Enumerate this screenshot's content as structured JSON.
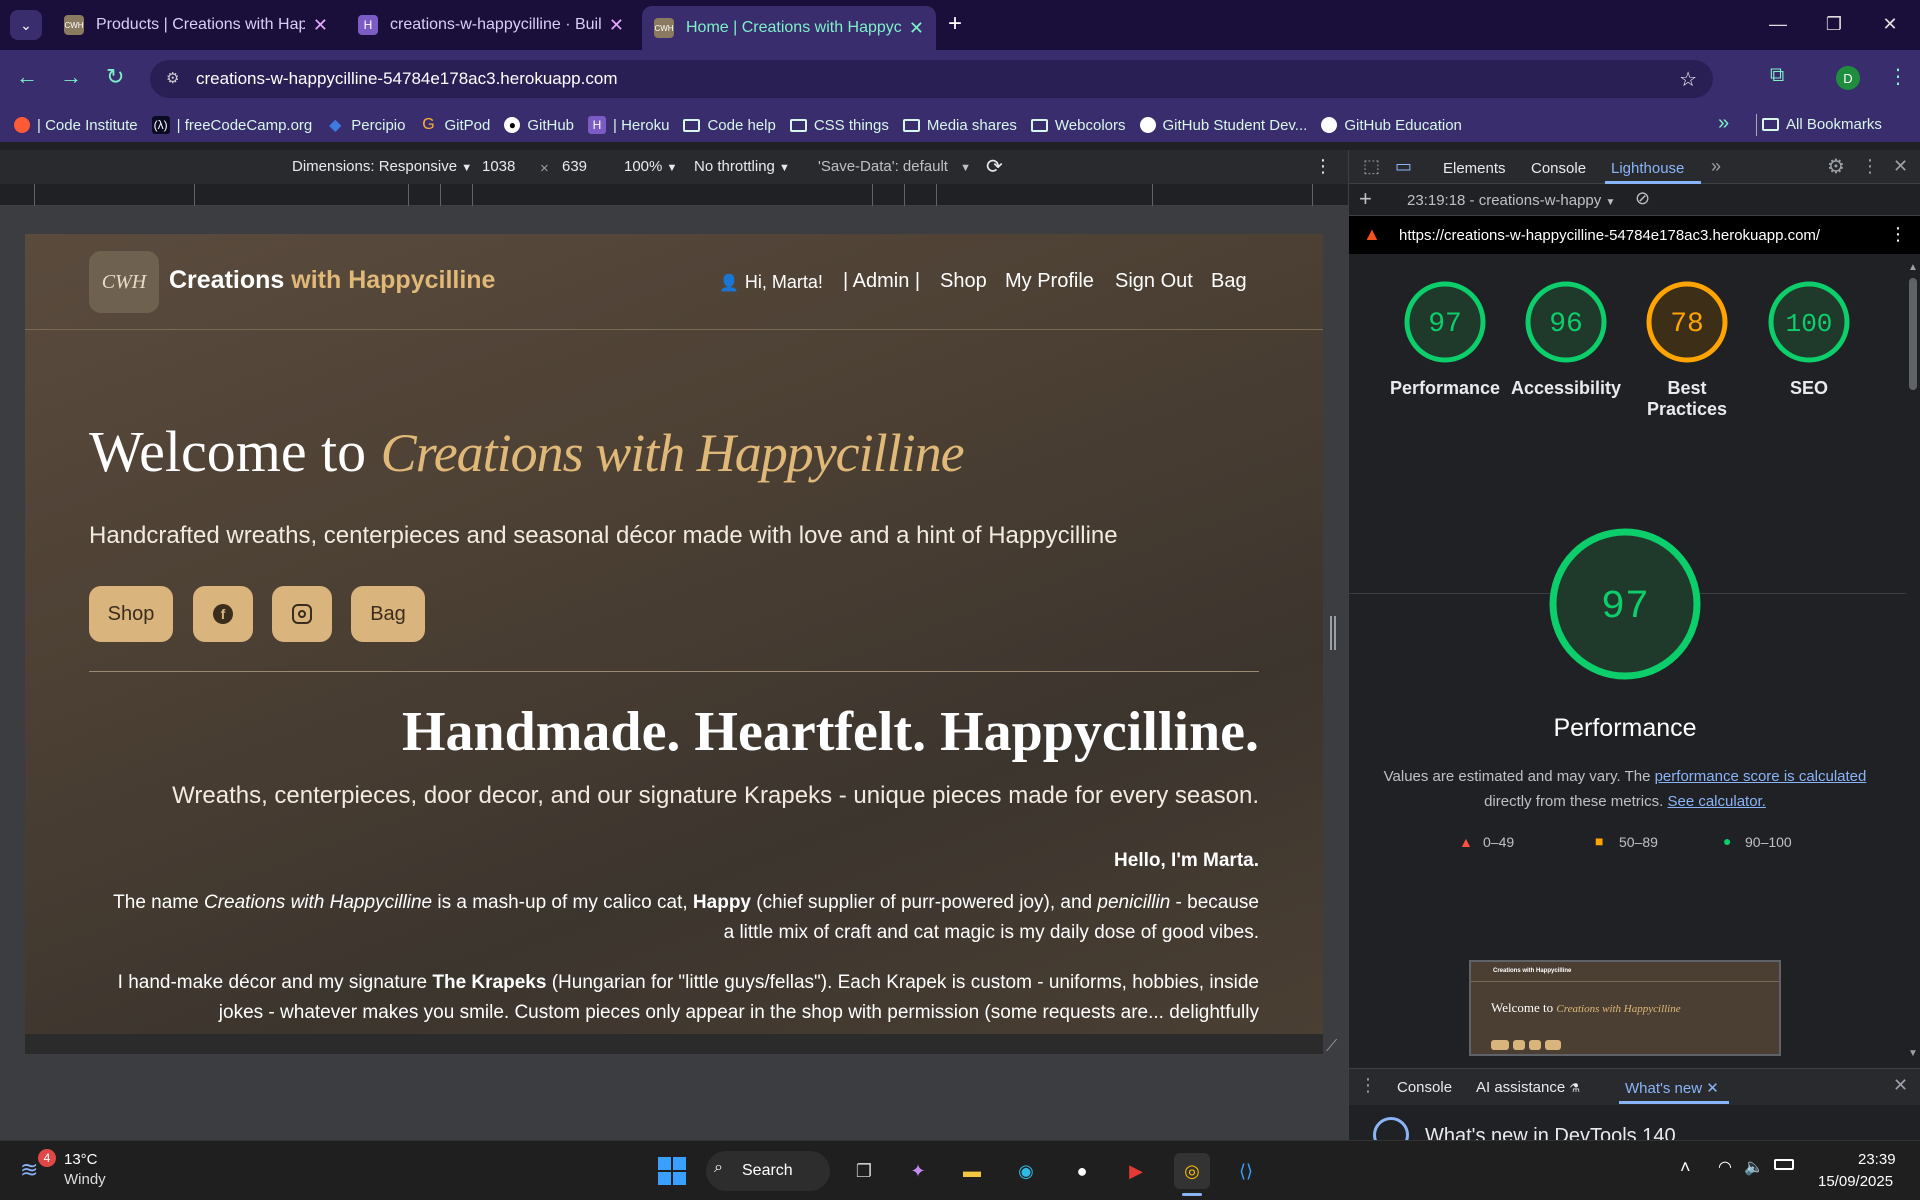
{
  "browser": {
    "tabs": [
      {
        "title": "Products | Creations with Happycilline",
        "favicon": "cwh-logo"
      },
      {
        "title": "creations-w-happycilline · Build",
        "favicon": "heroku-logo"
      },
      {
        "title": "Home | Creations with Happycilline",
        "favicon": "cwh-logo",
        "active": true
      }
    ],
    "url": "creations-w-happycilline-54784e178ac3.herokuapp.com",
    "profile_initial": "D",
    "bookmarks": [
      {
        "label": "| Code Institute",
        "icon": "code-institute-icon"
      },
      {
        "label": "| freeCodeCamp.org",
        "icon": "freecodecamp-icon"
      },
      {
        "label": "Percipio",
        "icon": "percipio-icon"
      },
      {
        "label": "GitPod",
        "icon": "gitpod-icon"
      },
      {
        "label": "GitHub",
        "icon": "github-icon"
      },
      {
        "label": "| Heroku",
        "icon": "heroku-icon"
      },
      {
        "label": "Code help",
        "icon": "folder-icon"
      },
      {
        "label": "CSS things",
        "icon": "folder-icon"
      },
      {
        "label": "Media shares",
        "icon": "folder-icon"
      },
      {
        "label": "Webcolors",
        "icon": "folder-icon"
      },
      {
        "label": "GitHub Student Dev...",
        "icon": "github-icon"
      },
      {
        "label": "GitHub Education",
        "icon": "github-icon"
      }
    ],
    "all_bookmarks": "All Bookmarks",
    "more": "»"
  },
  "devbar": {
    "dimensions": "Dimensions: Responsive",
    "width": "1038",
    "times": "×",
    "height": "639",
    "zoom": "100%",
    "throttling": "No throttling",
    "save_data": "'Save-Data': default"
  },
  "site": {
    "logo_text": "CWH",
    "brand_a": "Creations",
    "brand_b": "with Happycilline",
    "nav": {
      "greeting": "Hi, Marta!",
      "admin": "| Admin |",
      "shop": "Shop",
      "profile": "My Profile",
      "signout": "Sign Out",
      "bag": "Bag"
    },
    "welcome": "Welcome to",
    "welcome_script": "Creations with Happycilline",
    "tagline": "Handcrafted wreaths, centerpieces and seasonal décor made with love and a hint of Happycilline",
    "buttons": {
      "shop": "Shop",
      "bag": "Bag"
    },
    "headline": "Handmade. Heartfelt. Happycilline.",
    "subheadline": "Wreaths, centerpieces, door decor, and our signature Krapeks - unique pieces made for every season.",
    "hello": "Hello, I'm Marta.",
    "p1_a": "The name ",
    "p1_b": "Creations with Happycilline",
    "p1_c": " is a mash-up of my calico cat, ",
    "p1_d": "Happy",
    "p1_e": " (chief supplier of purr-powered joy), and ",
    "p1_f": "penicillin",
    "p1_g": " - because",
    "p1_line2": "a little mix of craft and cat magic is my daily dose of good vibes.",
    "p2_a": "I hand-make décor and my signature ",
    "p2_b": "The Krapeks",
    "p2_c": " (Hungarian for \"little guys/fellas\"). Each Krapek is custom - uniforms, hobbies, inside",
    "p2_line2": "jokes - whatever makes you smile. Custom pieces only appear in the shop with permission (some requests are... delightfully"
  },
  "devtools": {
    "tabs": {
      "elements": "Elements",
      "console": "Console",
      "lighthouse": "Lighthouse",
      "more": "»"
    },
    "report_select": "23:19:18 - creations-w-happy",
    "report_url": "https://creations-w-happycilline-54784e178ac3.herokuapp.com/",
    "scores": [
      {
        "label": "Performance",
        "value": 97,
        "color": "#0cce6b"
      },
      {
        "label": "Accessibility",
        "value": 96,
        "color": "#0cce6b"
      },
      {
        "label": "Best Practices",
        "value": 78,
        "color": "#ffa400"
      },
      {
        "label": "SEO",
        "value": 100,
        "color": "#0cce6b"
      }
    ],
    "big_score": {
      "value": 97,
      "label": "Performance"
    },
    "note_a": "Values are estimated and may vary. The ",
    "note_link1": "performance score is calculated",
    "note_b": "directly from these metrics.",
    "note_link2": "See calculator.",
    "legend": [
      "0–49",
      "50–89",
      "90–100"
    ],
    "drawer_tabs": {
      "console": "Console",
      "ai": "AI assistance",
      "whatsnew": "What's new"
    },
    "whatsnew_title": "What's new in DevTools 140"
  },
  "thumbnail": {
    "brand": "Creations with Happycilline",
    "welcome": "Welcome to",
    "welcome_script": "Creations with Happycilline"
  },
  "taskbar": {
    "weather_temp": "13°C",
    "weather_desc": "Windy",
    "weather_badge": "4",
    "search": "Search",
    "time": "23:39",
    "date": "15/09/2025"
  }
}
